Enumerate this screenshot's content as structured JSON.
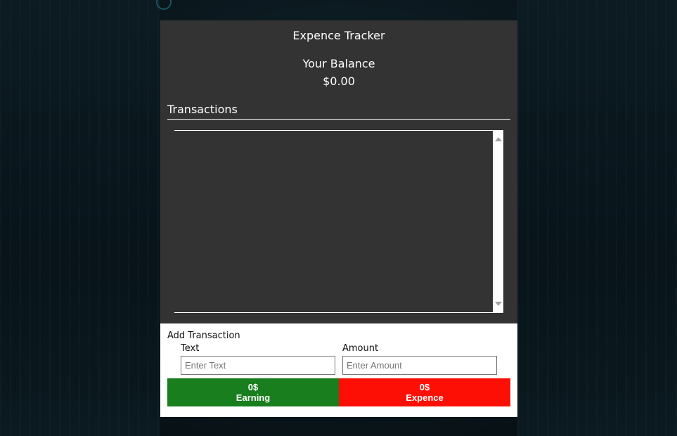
{
  "app": {
    "title": "Expence Tracker"
  },
  "balance": {
    "label": "Your Balance",
    "value": "$0.00"
  },
  "transactions": {
    "heading": "Transactions",
    "items": []
  },
  "form": {
    "title": "Add Transaction",
    "text_label": "Text",
    "text_placeholder": "Enter Text",
    "text_value": "",
    "amount_label": "Amount",
    "amount_placeholder": "Enter Amount",
    "amount_value": ""
  },
  "buttons": {
    "earning_amount": "0$",
    "earning_label": "Earning",
    "expense_amount": "0$",
    "expense_label": "Expence"
  },
  "colors": {
    "panel": "#333333",
    "earning": "#197e1e",
    "expense": "#fd0f06"
  }
}
